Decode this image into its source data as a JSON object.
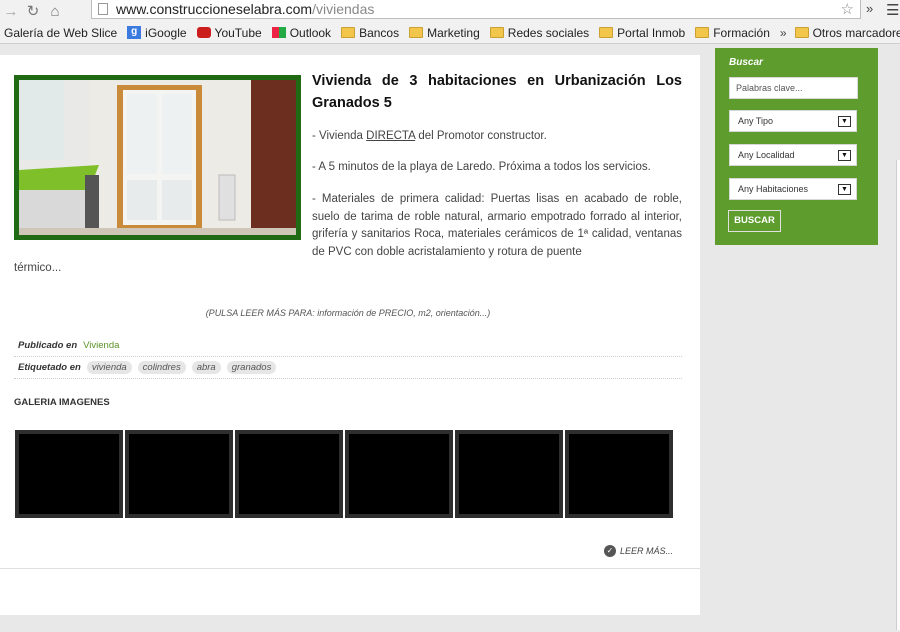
{
  "browser": {
    "url_host": "www.construccioneselabra.com",
    "url_path": "/viviendas",
    "back_icon": "arrow-left-icon",
    "forward_icon": "arrow-right-icon",
    "reload_icon": "reload-icon",
    "home_icon": "home-icon",
    "more_chevron": "»",
    "bookmarks": [
      {
        "label": "Galería de Web Slice",
        "icon": "web-slice-icon"
      },
      {
        "label": "iGoogle",
        "icon": "google-icon"
      },
      {
        "label": "YouTube",
        "icon": "youtube-icon"
      },
      {
        "label": "Outlook",
        "icon": "windows-icon"
      },
      {
        "label": "Bancos",
        "icon": "folder-icon"
      },
      {
        "label": "Marketing",
        "icon": "folder-icon"
      },
      {
        "label": "Redes sociales",
        "icon": "folder-icon"
      },
      {
        "label": "Portal Inmob",
        "icon": "folder-icon"
      },
      {
        "label": "Formación",
        "icon": "folder-icon"
      }
    ],
    "bookmarks_more": "»",
    "other_bookmarks": "Otros marcadores"
  },
  "article": {
    "title": "Vivienda de 3 habitaciones en Urbanización Los Granados 5",
    "p1_prefix": " - Vivienda ",
    "p1_link": "DIRECTA",
    "p1_suffix": " del Promotor constructor.",
    "p2": "- A 5 minutos de la playa de Laredo. Próxima a todos los servicios.",
    "p3": "- Materiales de primera calidad: Puertas lisas en acabado de roble, suelo de tarima de roble natural, armario empotrado forrado al interior, grifería y sanitarios Roca, materiales cerámicos de 1ª calidad, ventanas de PVC con doble acristalamiento y rotura de puente",
    "p4": "térmico...",
    "note": "(PULSA LEER MÁS PARA: información de PRECIO, m2, orientación...)",
    "published_label": "Publicado en",
    "category": "Vivienda",
    "tagged_label": "Etiquetado en",
    "tags": [
      "vivienda",
      "colindres",
      "abra",
      "granados"
    ],
    "gallery_title": "GALERIA IMAGENES",
    "read_more": "LEER MÁS..."
  },
  "sidebar": {
    "title": "Buscar",
    "keywords_value": "Palabras clave...",
    "select_tipo": "Any Tipo",
    "select_localidad": "Any Localidad",
    "select_habitaciones": "Any Habitaciones",
    "search_button": "BUSCAR"
  },
  "colors": {
    "brand_green": "#5d9c2d",
    "image_border": "#1f6a12"
  }
}
